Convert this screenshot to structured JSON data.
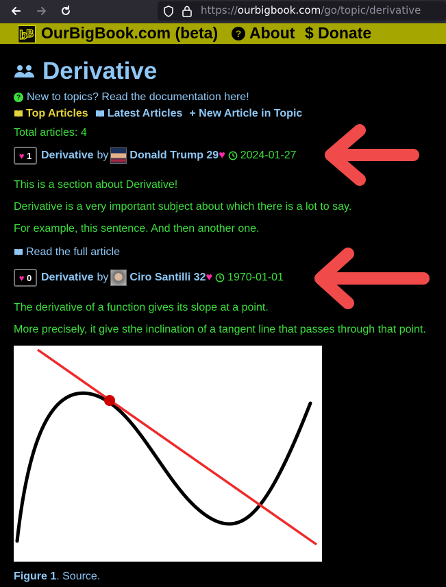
{
  "browser": {
    "url_prefix": "https://",
    "url_host": "ourbigbook.com",
    "url_path": "/go/topic/derivative"
  },
  "site_header": {
    "logo_text": "OurBigBook.com (beta)",
    "about_label": "About",
    "donate_label": "$ Donate"
  },
  "topic": {
    "title": "Derivative",
    "help_text": "New to topics? Read the documentation here!",
    "tabs": [
      "Top Articles",
      "Latest Articles",
      "+ New Article in Topic"
    ],
    "total_articles": "Total articles: 4"
  },
  "articles": [
    {
      "likes": "1",
      "title": "Derivative",
      "by": "by",
      "author": "Donald Trump 29",
      "date": "2024-01-27",
      "paragraphs": [
        "This is a section about Derivative!",
        "Derivative is a very important subject about which there is a lot to say.",
        "For example, this sentence. And then another one."
      ],
      "read_full": "Read the full article"
    },
    {
      "likes": "0",
      "title": "Derivative",
      "by": "by",
      "author": "Ciro Santilli 32",
      "date": "1970-01-01",
      "paragraphs": [
        "The derivative of a function gives its slope at a point.",
        "More precisely, it give sthe inclination of a tangent line that passes through that point."
      ]
    }
  ],
  "figure": {
    "label": "Figure 1",
    "caption": ". Source."
  },
  "colors": {
    "link_blue": "#8ec7f5",
    "text_green": "#3cdd3c",
    "header_yellow": "#a6a600",
    "heart_pink": "#ff2aa6",
    "arrow_red": "#f04a4a"
  }
}
